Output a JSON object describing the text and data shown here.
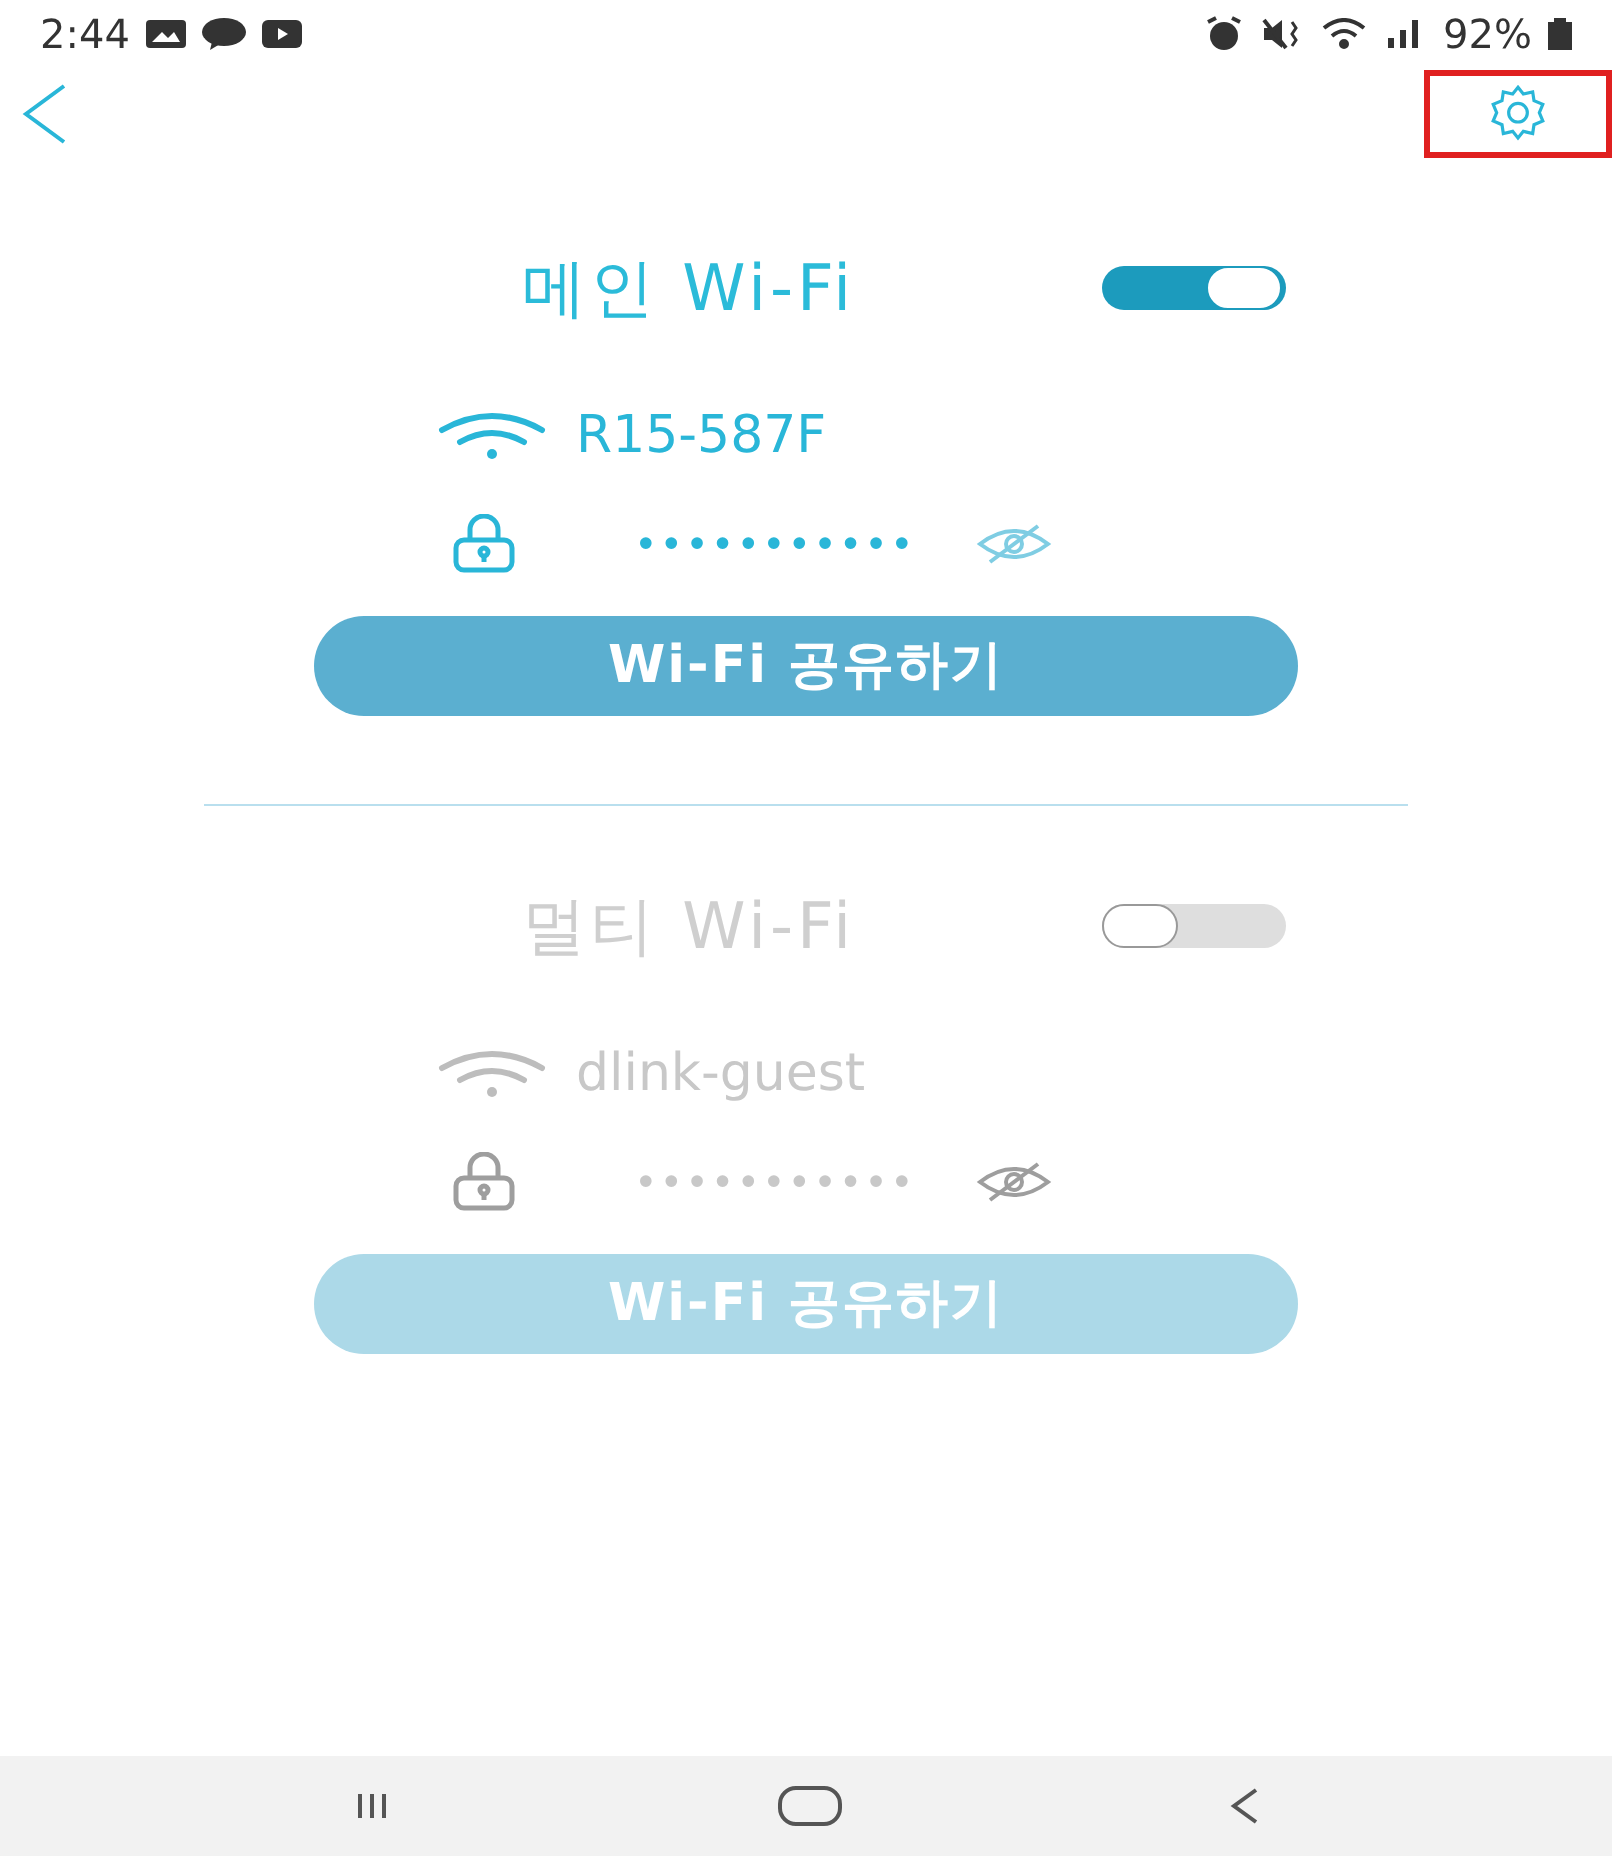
{
  "status_bar": {
    "time": "2:44",
    "battery_text": "92%"
  },
  "networks": [
    {
      "title": "메인 Wi-Fi",
      "on": true,
      "ssid": "R15-587F",
      "password": "•••••••••••",
      "share_button": "Wi-Fi 공유하기"
    },
    {
      "title": "멀티 Wi-Fi",
      "on": false,
      "ssid": "dlink-guest",
      "password": "•••••••••••",
      "share_button": "Wi-Fi 공유하기"
    }
  ]
}
